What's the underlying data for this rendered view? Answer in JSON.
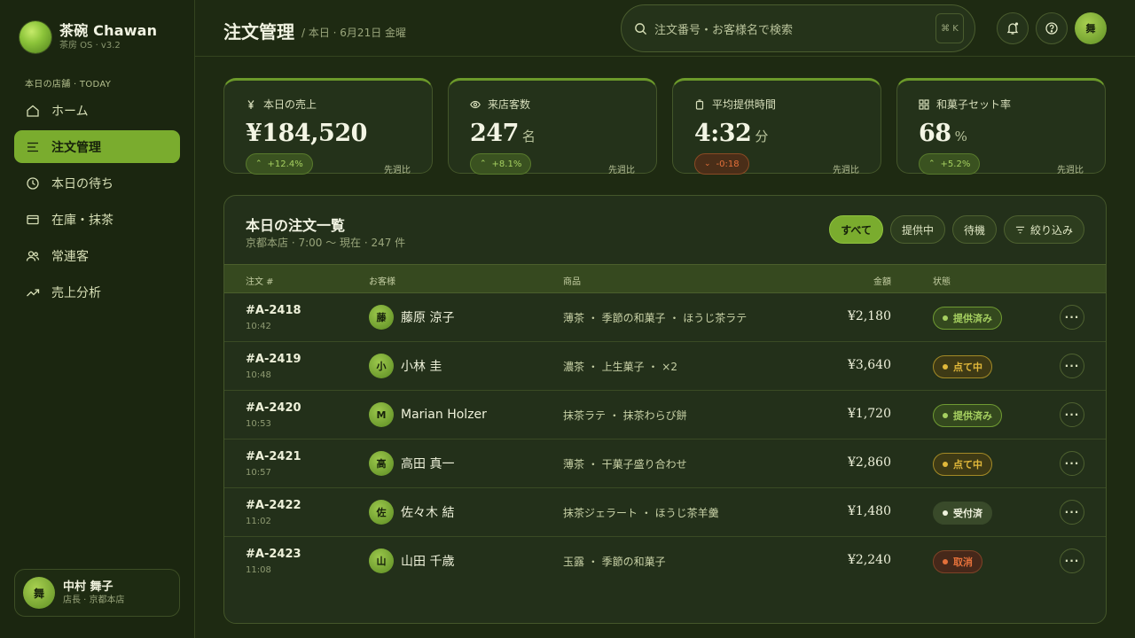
{
  "brand": {
    "name": "茶碗 Chawan",
    "sub": "茶房 OS · v3.2"
  },
  "sidebar": {
    "section": "本日の店舗 · TODAY",
    "items": [
      {
        "label": "ホーム",
        "icon": "home-icon"
      },
      {
        "label": "注文管理",
        "icon": "list-icon",
        "active": true
      },
      {
        "label": "本日の待ち",
        "icon": "clock-icon"
      },
      {
        "label": "在庫・抹茶",
        "icon": "box-icon"
      },
      {
        "label": "常連客",
        "icon": "users-icon"
      },
      {
        "label": "売上分析",
        "icon": "trend-icon"
      }
    ],
    "user": {
      "avatar": "舞",
      "name": "中村 舞子",
      "role": "店長 · 京都本店"
    }
  },
  "header": {
    "title": "注文管理",
    "subtitle": "/ 本日 · 6月21日 金曜",
    "search_placeholder": "注文番号・お客様名で検索",
    "shortcut": "⌘ K",
    "avatar": "舞"
  },
  "kpis": [
    {
      "label": "本日の売上",
      "value": "¥184,520",
      "unit": "",
      "delta": "+12.4%",
      "direction": "up",
      "compare": "先週比",
      "icon": "yen-icon"
    },
    {
      "label": "来店客数",
      "value": "247",
      "unit": "名",
      "delta": "+8.1%",
      "direction": "up",
      "compare": "先週比",
      "icon": "eye-icon"
    },
    {
      "label": "平均提供時間",
      "value": "4:32",
      "unit": "分",
      "delta": "-0:18",
      "direction": "down",
      "compare": "先週比",
      "icon": "timer-icon"
    },
    {
      "label": "和菓子セット率",
      "value": "68",
      "unit": "%",
      "delta": "+5.2%",
      "direction": "up",
      "compare": "先週比",
      "icon": "grid-icon"
    }
  ],
  "orders": {
    "title": "本日の注文一覧",
    "subtitle": "京都本店 · 7:00 〜 現在 · 247 件",
    "filters": [
      "すべて",
      "提供中",
      "待機",
      "絞り込み"
    ],
    "columns": [
      "注文 #",
      "お客様",
      "商品",
      "金額",
      "状態"
    ],
    "rows": [
      {
        "id": "#A-2418",
        "time": "10:42",
        "initial": "藤",
        "customer": "藤原 涼子",
        "items": "薄茶 ・ 季節の和菓子 ・ ほうじ茶ラテ",
        "amount": "¥2,180",
        "status": "提供済み",
        "status_type": "done"
      },
      {
        "id": "#A-2419",
        "time": "10:48",
        "initial": "小",
        "customer": "小林 圭",
        "items": "濃茶 ・ 上生菓子 ・ ×2",
        "amount": "¥3,640",
        "status": "点て中",
        "status_type": "prog"
      },
      {
        "id": "#A-2420",
        "time": "10:53",
        "initial": "M",
        "customer": "Marian Holzer",
        "items": "抹茶ラテ ・ 抹茶わらび餅",
        "amount": "¥1,720",
        "status": "提供済み",
        "status_type": "done"
      },
      {
        "id": "#A-2421",
        "time": "10:57",
        "initial": "高",
        "customer": "高田 真一",
        "items": "薄茶 ・ 干菓子盛り合わせ",
        "amount": "¥2,860",
        "status": "点て中",
        "status_type": "prog"
      },
      {
        "id": "#A-2422",
        "time": "11:02",
        "initial": "佐",
        "customer": "佐々木 結",
        "items": "抹茶ジェラート ・ ほうじ茶羊羹",
        "amount": "¥1,480",
        "status": "受付済",
        "status_type": "paid"
      },
      {
        "id": "#A-2423",
        "time": "11:08",
        "initial": "山",
        "customer": "山田 千歳",
        "items": "玉露 ・ 季節の和菓子",
        "amount": "¥2,240",
        "status": "取消",
        "status_type": "cancel"
      }
    ]
  },
  "colors": {
    "accent": "#7aac2e",
    "background": "#1e2a12",
    "panel": "#23301a",
    "warning": "#e1b83a",
    "danger": "#e4703a"
  }
}
